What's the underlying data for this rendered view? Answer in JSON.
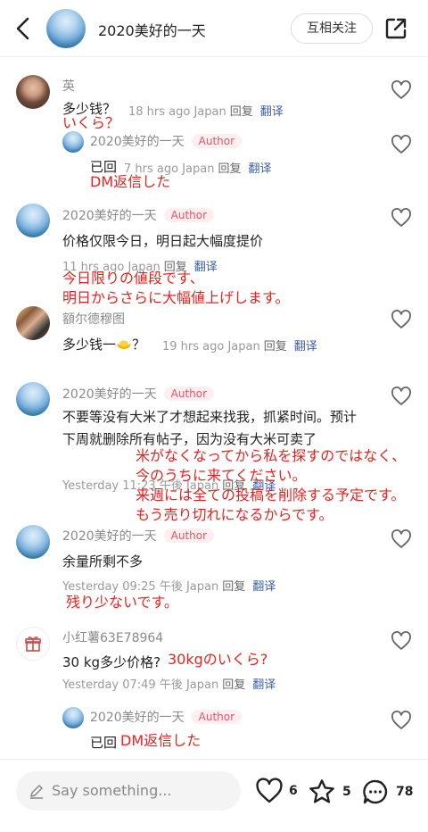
{
  "header": {
    "title": "2020美好的一天",
    "follow_label": "互相关注"
  },
  "common": {
    "author_badge": "Author",
    "reply_label": "回复",
    "translate_label": "翻译"
  },
  "comments": [
    {
      "user": "英",
      "text": "多少钱？",
      "time": "18 hrs ago Japan",
      "note": "いくら？"
    },
    {
      "user": "2020美好的一天",
      "text": "已回",
      "time": "7 hrs ago Japan",
      "note": "DM返信した"
    },
    {
      "user": "2020美好的一天",
      "text": "价格仅限今日，明日起大幅度提价",
      "time": "11 hrs ago Japan",
      "note_line1": "今日限りの値段です、",
      "note_line2": "明日からさらに大幅値上げします。"
    },
    {
      "user": "額尔德穆图",
      "text": "多少钱一",
      "text_suffix": "？",
      "time": "19 hrs ago Japan"
    },
    {
      "user": "2020美好的一天",
      "text": "不要等没有大米了才想起来找我，抓紧时间。预计下周就删除所有帖子，因为没有大米可卖了",
      "time": "Yesterday 11:23 午後 Japan",
      "note_line1": "米がなくなってから私を探すのではなく、",
      "note_line2": "今のうちに来てください。",
      "note_line3": "来週には全ての投稿を削除する予定です。",
      "note_line4": "もう売り切れになるからです。"
    },
    {
      "user": "2020美好的一天",
      "text": "余量所剩不多",
      "time": "Yesterday 09:25 午後 Japan",
      "note": "残り少ないです。"
    },
    {
      "user": "小红薯63E78964",
      "text": "30 kg多少价格?",
      "time": "Yesterday 07:49 午後 Japan",
      "note": "30kgのいくら?"
    },
    {
      "user": "2020美好的一天",
      "text": "已回",
      "note": "DM返信した"
    }
  ],
  "footer": {
    "placeholder": "Say something...",
    "likes": "6",
    "stars": "5",
    "comments": "78"
  },
  "colors": {
    "note": "#e8231f",
    "badge": "#e0566a",
    "translate": "#3b5ea8"
  },
  "icons": [
    "back-arrow-icon",
    "share-icon",
    "heart-icon",
    "pencil-icon",
    "star-icon",
    "chat-bubble-icon",
    "gift-icon",
    "gold-ingot-icon"
  ]
}
